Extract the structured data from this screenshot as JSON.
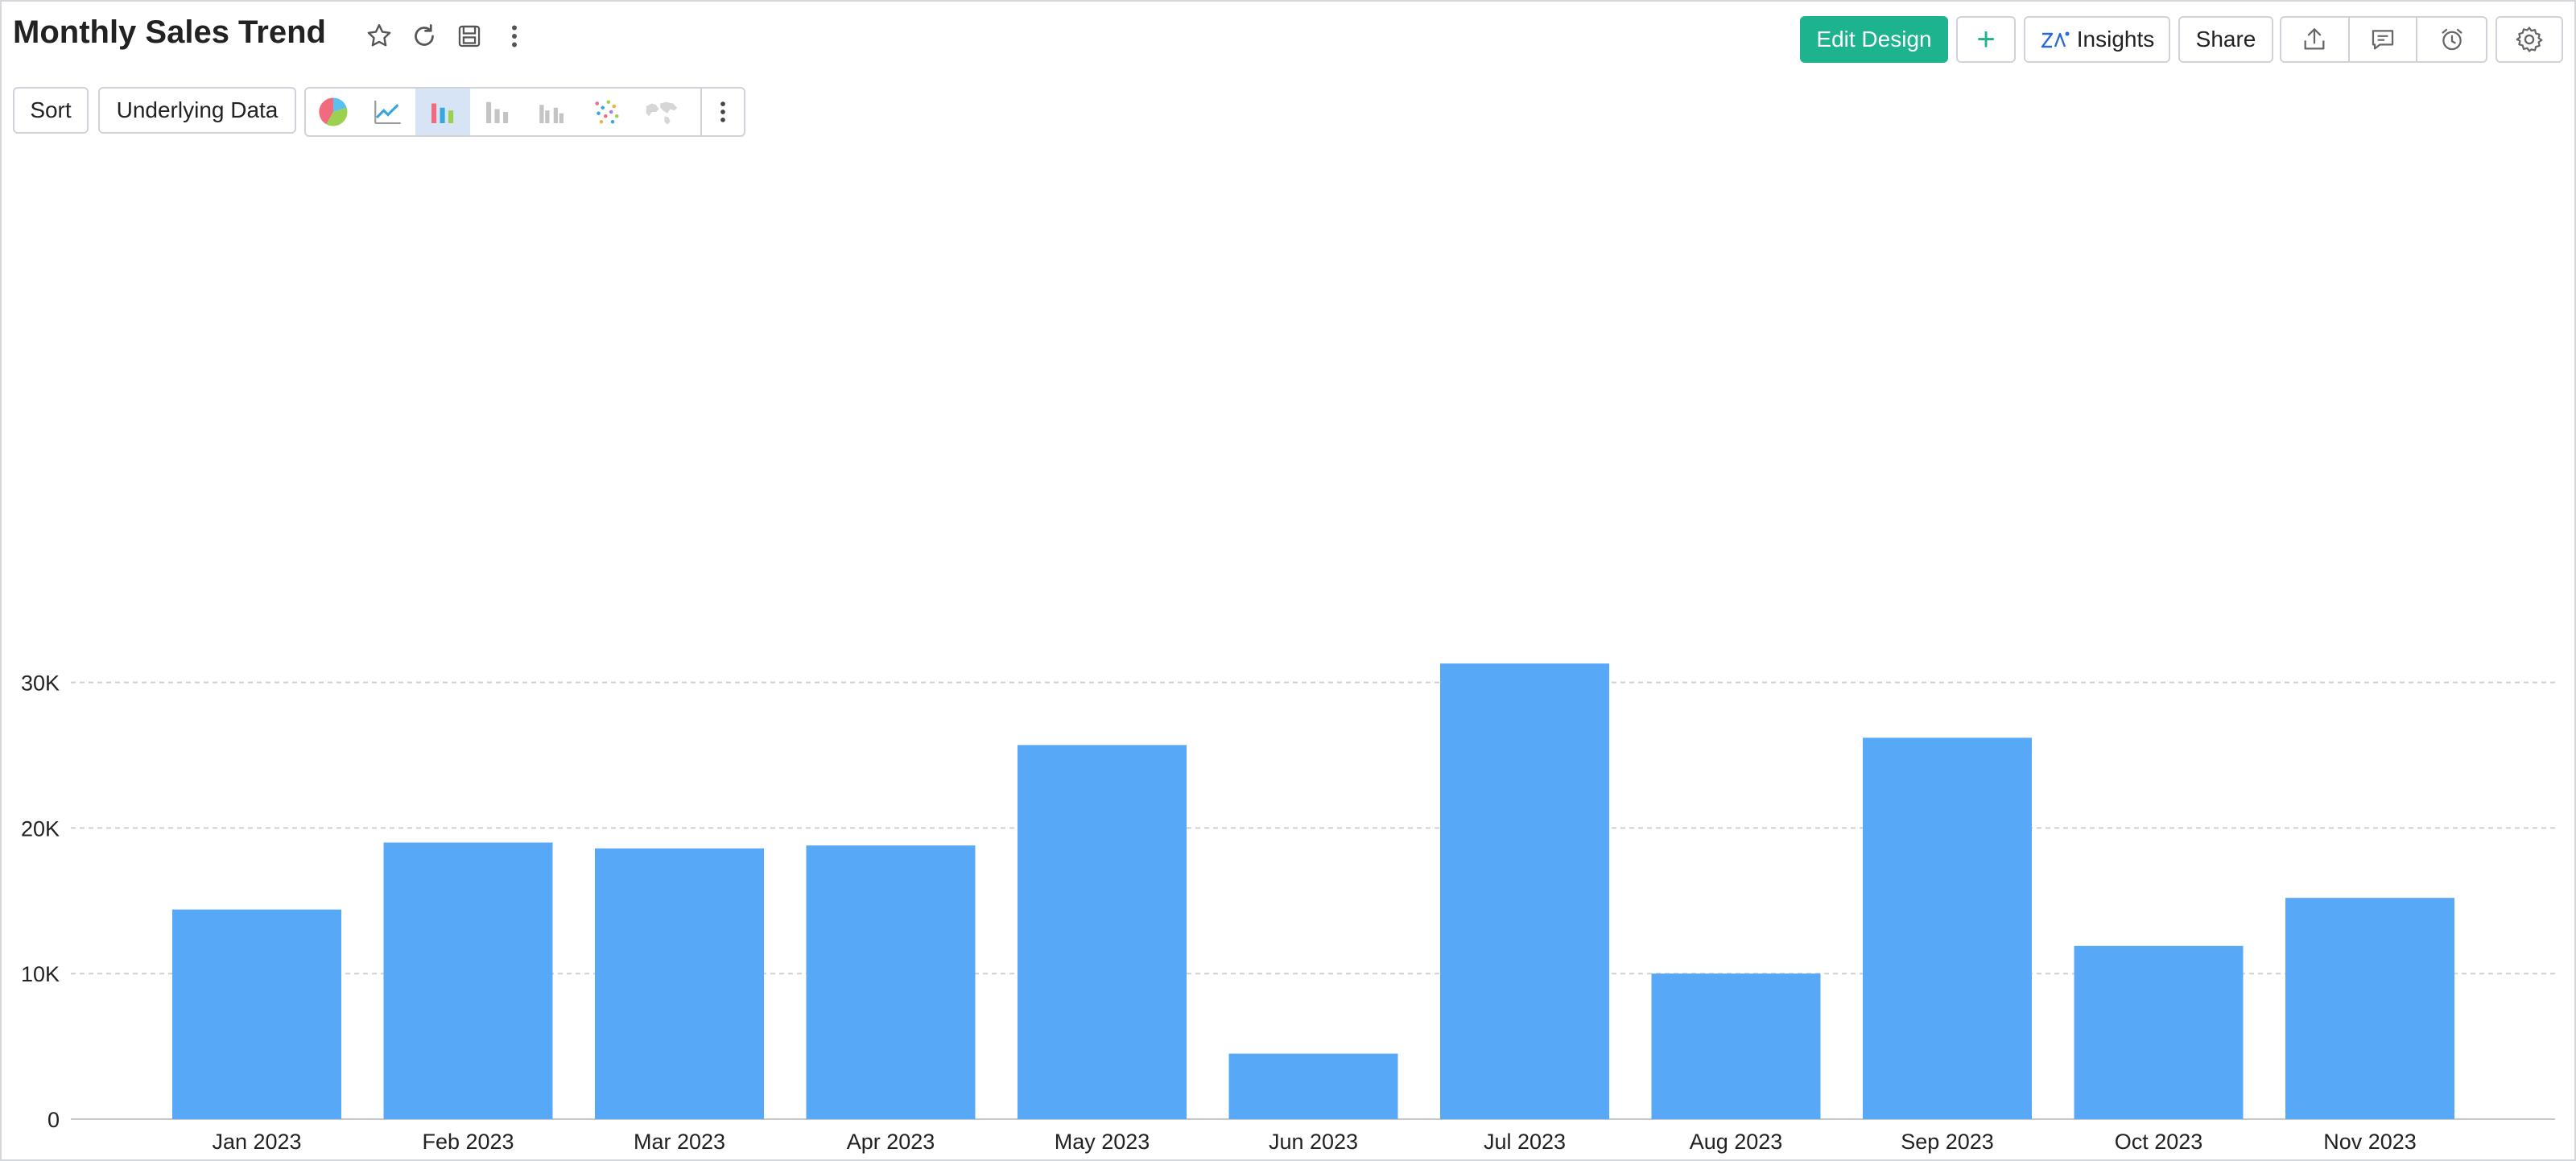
{
  "header": {
    "title": "Monthly Sales Trend"
  },
  "toolbar": {
    "edit_design_label": "Edit Design",
    "add_label": "+",
    "insights_label": "Insights",
    "share_label": "Share"
  },
  "subtoolbar": {
    "sort_label": "Sort",
    "underlying_data_label": "Underlying Data"
  },
  "colors": {
    "accent": "#1db38e",
    "bar": "#58a8f8",
    "active_chart_type_bg": "#d6e4f5"
  },
  "chart_data": {
    "type": "bar",
    "categories": [
      "Jan 2023",
      "Feb 2023",
      "Mar 2023",
      "Apr 2023",
      "May 2023",
      "Jun 2023",
      "Jul 2023",
      "Aug 2023",
      "Sep 2023",
      "Oct 2023",
      "Nov 2023"
    ],
    "values": [
      14400,
      19000,
      18600,
      18800,
      25700,
      4500,
      31300,
      10000,
      26200,
      11900,
      15200
    ],
    "yticks": [
      0,
      10000,
      20000,
      30000
    ],
    "ytick_labels": [
      "0",
      "10K",
      "20K",
      "30K"
    ],
    "ylim": [
      0,
      34200
    ],
    "grid": true
  }
}
